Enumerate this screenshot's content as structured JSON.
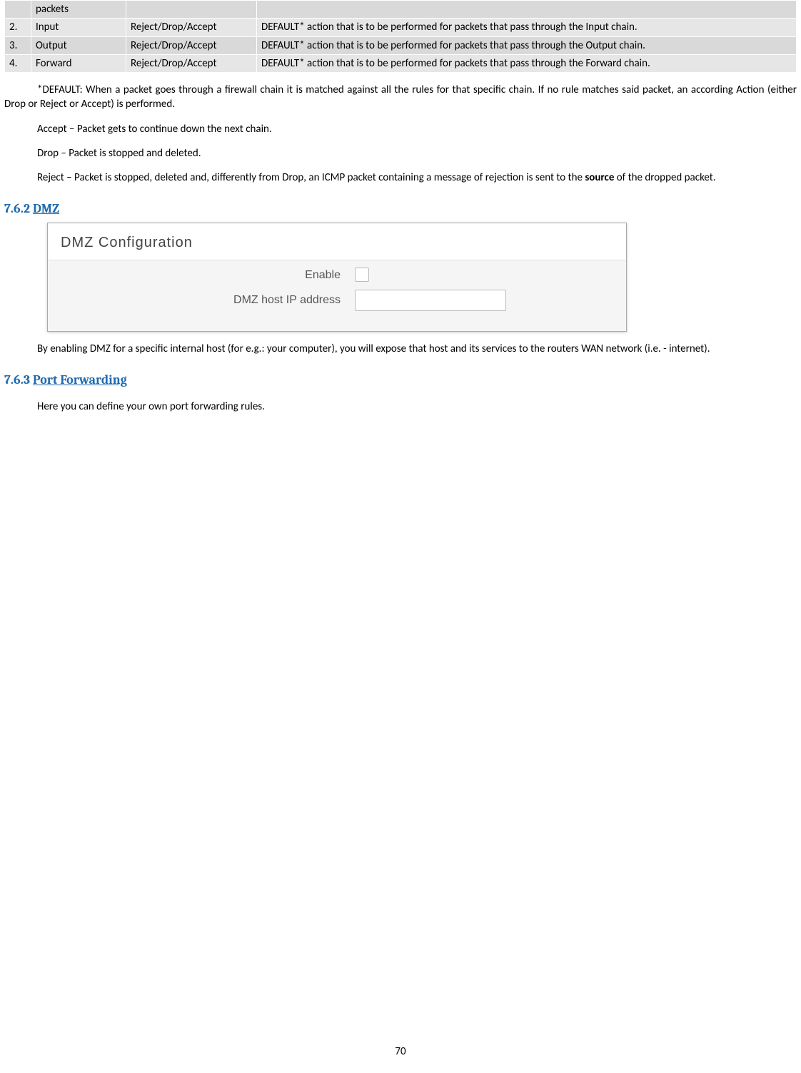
{
  "table": {
    "rows": [
      {
        "num": "",
        "name": "packets",
        "val": "",
        "desc": ""
      },
      {
        "num": "2.",
        "name": "Input",
        "val": "Reject/Drop/Accept",
        "desc": "DEFAULT* action that is to be performed for packets that pass through the Input chain."
      },
      {
        "num": "3.",
        "name": "Output",
        "val": "Reject/Drop/Accept",
        "desc": "DEFAULT* action that is to be performed for packets that pass through the Output chain."
      },
      {
        "num": "4.",
        "name": "Forward",
        "val": "Reject/Drop/Accept",
        "desc": "DEFAULT* action that is to be performed for packets that pass through the Forward chain."
      }
    ]
  },
  "paragraphs": {
    "default_note": "*DEFAULT: When a packet goes through a firewall chain it is matched against all the rules for that specific chain. If no rule matches said packet, an according Action (either Drop or Reject or Accept) is performed.",
    "accept": "Accept – Packet gets to continue down the next chain.",
    "drop": "Drop – Packet is stopped and deleted.",
    "reject_part1": "Reject – Packet is stopped, deleted and, differently from Drop, an ICMP packet containing a message of rejection is sent to the ",
    "reject_bold": "source",
    "reject_part2": " of the dropped packet.",
    "dmz_desc": "By enabling DMZ for a specific internal host (for e.g.: your computer), you will expose that host and its services to the routers WAN network (i.e. - internet).",
    "port_fwd_desc": "Here you can define your own port forwarding rules."
  },
  "sections": {
    "dmz_num": "7.6.2",
    "dmz_title": "DMZ",
    "pf_num": "7.6.3",
    "pf_title": "Port Forwarding"
  },
  "dmz_panel": {
    "title": "DMZ Configuration",
    "enable_label": "Enable",
    "ip_label": "DMZ host IP address"
  },
  "page_number": "70"
}
